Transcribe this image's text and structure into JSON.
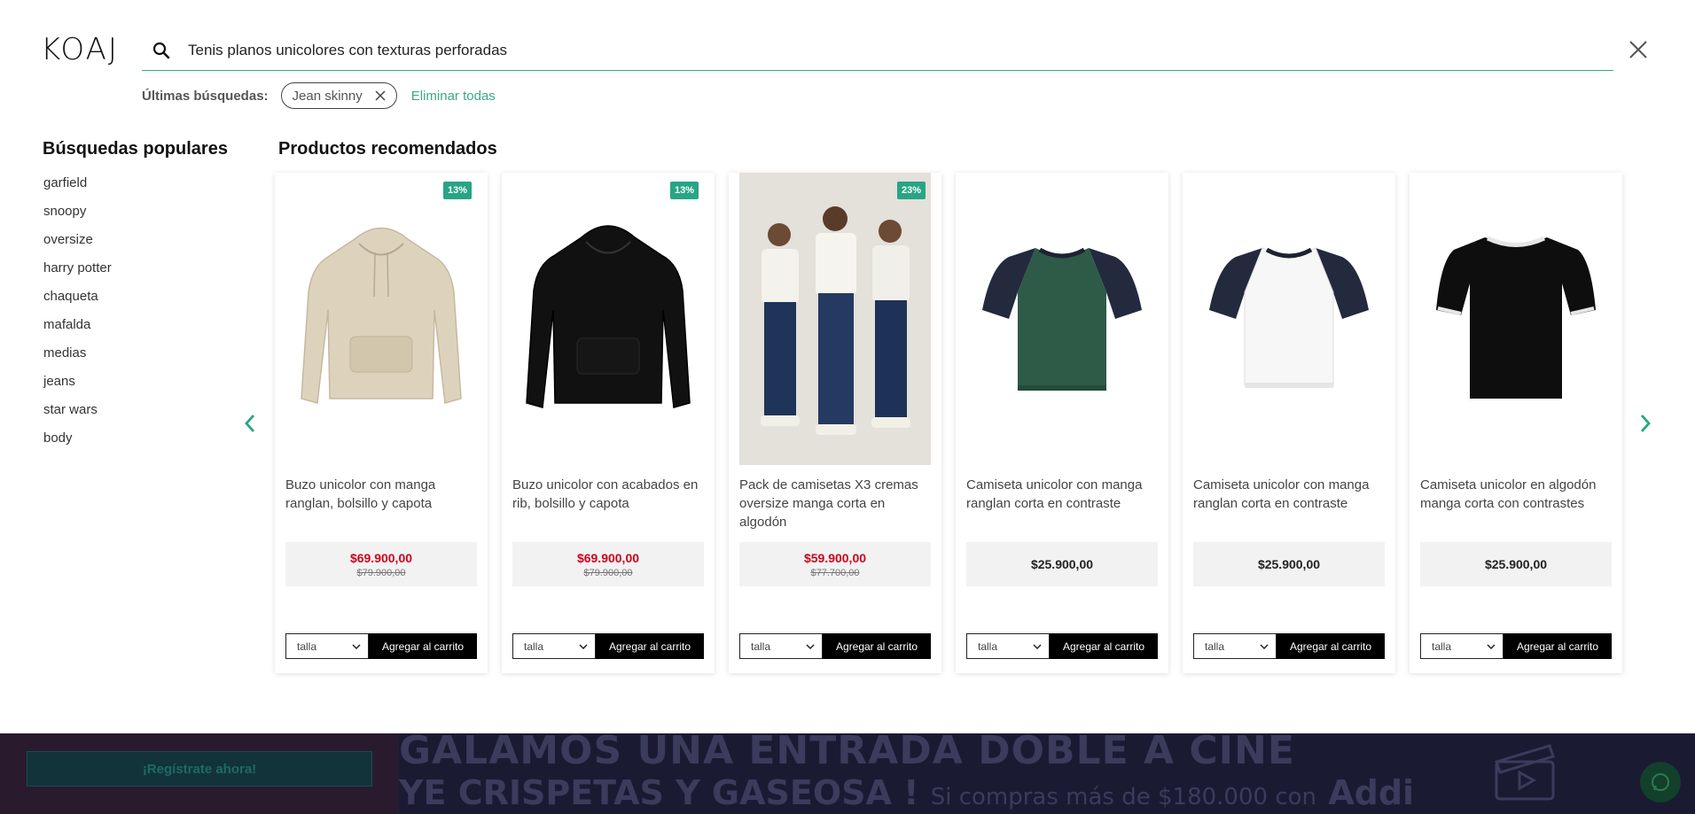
{
  "header": {
    "logo": "KOAJ",
    "search_value": "Tenis planos unicolores con texturas perforadas"
  },
  "recent": {
    "label": "Últimas búsquedas:",
    "chips": [
      "Jean skinny"
    ],
    "clear_all": "Eliminar todas"
  },
  "popular": {
    "title": "Búsquedas populares",
    "items": [
      "garfield",
      "snoopy",
      "oversize",
      "harry potter",
      "chaqueta",
      "mafalda",
      "medias",
      "jeans",
      "star wars",
      "body"
    ]
  },
  "recommended": {
    "title": "Productos recomendados",
    "size_label": "talla",
    "add_label": "Agregar al carrito",
    "products": [
      {
        "name": "Buzo unicolor con manga ranglan, bolsillo y capota",
        "badge": "13%",
        "price": "$69.900,00",
        "old_price": "$79.900,00",
        "image": "beige-hoodie"
      },
      {
        "name": "Buzo unicolor con acabados en rib, bolsillo y capota",
        "badge": "13%",
        "price": "$69.900,00",
        "old_price": "$79.900,00",
        "image": "black-hoodie"
      },
      {
        "name": "Pack de camisetas X3 cremas oversize manga corta en algodón",
        "badge": "23%",
        "price": "$59.900,00",
        "old_price": "$77.700,00",
        "image": "three-models-photo"
      },
      {
        "name": "Camiseta unicolor con manga ranglan corta en contraste",
        "badge": "",
        "price": "$25.900,00",
        "old_price": "",
        "image": "green-navy-raglan-tee"
      },
      {
        "name": "Camiseta unicolor con manga ranglan corta en contraste",
        "badge": "",
        "price": "$25.900,00",
        "old_price": "",
        "image": "white-navy-raglan-tee"
      },
      {
        "name": "Camiseta unicolor en algodón manga corta con contrastes",
        "badge": "",
        "price": "$25.900,00",
        "old_price": "",
        "image": "black-ringer-tee"
      }
    ]
  },
  "banner": {
    "register_label": "¡Regístrate ahora!",
    "line1": "GALAMOS UNA ENTRADA DOBLE A CINE",
    "line2": "YE CRISPETAS Y GASEOSA !",
    "line2_small": "Si compras más de $180.000 con",
    "brand": "Addi"
  },
  "colors": {
    "accent": "#27a585",
    "sale": "#d0021b",
    "banner_bg": "#1a1a33"
  }
}
